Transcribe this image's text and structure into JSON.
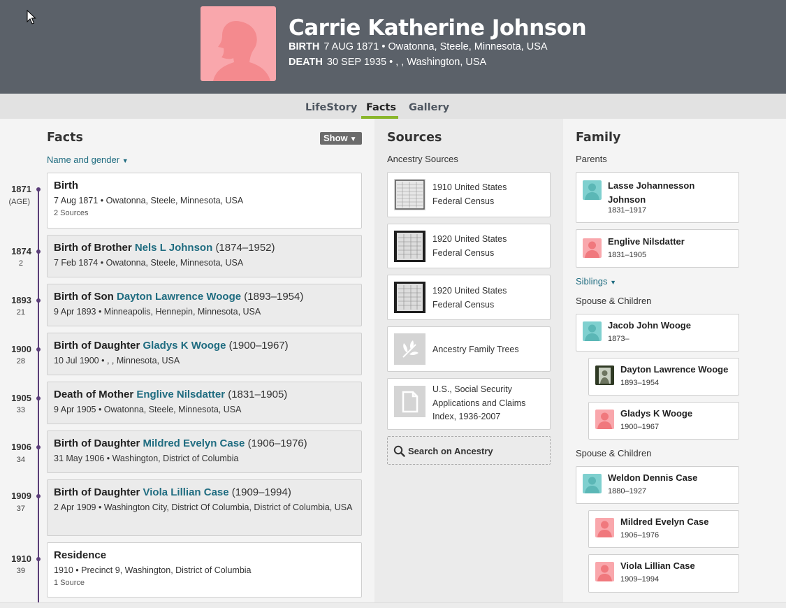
{
  "header": {
    "name": "Carrie Katherine Johnson",
    "birth_label": "BIRTH",
    "birth_value": "7 AUG 1871 • Owatonna, Steele, Minnesota, USA",
    "death_label": "DEATH",
    "death_value": "30 SEP 1935 • , , Washington, USA",
    "portrait_icon": "female-silhouette-icon",
    "portrait_color": "#f9a7ac"
  },
  "tabs": [
    "LifeStory",
    "Facts",
    "Gallery"
  ],
  "active_tab": "Facts",
  "facts": {
    "title": "Facts",
    "show_label": "Show",
    "name_gender_label": "Name and gender",
    "events": [
      {
        "year": "1871",
        "age": "(AGE)",
        "title": "Birth",
        "link": "",
        "years": "",
        "detail": "7 Aug 1871 • Owatonna, Steele, Minnesota, USA",
        "sources": "2 Sources"
      },
      {
        "year": "1874",
        "age": "2",
        "title": "Birth of Brother",
        "link": "Nels L Johnson",
        "years": "(1874–1952)",
        "detail": "7 Feb 1874 • Owatonna, Steele, Minnesota, USA",
        "sources": ""
      },
      {
        "year": "1893",
        "age": "21",
        "title": "Birth of Son",
        "link": "Dayton Lawrence Wooge",
        "years": "(1893–1954)",
        "detail": "9 Apr 1893 • Minneapolis, Hennepin, Minnesota, USA",
        "sources": ""
      },
      {
        "year": "1900",
        "age": "28",
        "title": "Birth of Daughter",
        "link": "Gladys K Wooge",
        "years": "(1900–1967)",
        "detail": "10 Jul 1900 • , , Minnesota, USA",
        "sources": ""
      },
      {
        "year": "1905",
        "age": "33",
        "title": "Death of Mother",
        "link": "Englive Nilsdatter",
        "years": "(1831–1905)",
        "detail": "9 Apr 1905 • Owatonna, Steele, Minnesota, USA",
        "sources": ""
      },
      {
        "year": "1906",
        "age": "34",
        "title": "Birth of Daughter",
        "link": "Mildred Evelyn Case",
        "years": "(1906–1976)",
        "detail": "31 May 1906 • Washington, District of Columbia",
        "sources": ""
      },
      {
        "year": "1909",
        "age": "37",
        "title": "Birth of Daughter",
        "link": "Viola Lillian Case",
        "years": "(1909–1994)",
        "detail": "2 Apr 1909 • Washington City, District Of Columbia, District of Columbia, USA",
        "sources": ""
      },
      {
        "year": "1910",
        "age": "39",
        "title": "Residence",
        "link": "",
        "years": "",
        "detail": "1910 • Precinct 9, Washington, District of Columbia",
        "sources": "1 Source"
      }
    ]
  },
  "sources": {
    "title": "Sources",
    "subtitle": "Ancestry Sources",
    "items": [
      {
        "line1": "1910 United States",
        "line2": "Federal Census",
        "line3": "",
        "icon": "census-document-thumb"
      },
      {
        "line1": "1920 United States",
        "line2": "Federal Census",
        "line3": "",
        "icon": "census-document-thumb"
      },
      {
        "line1": "1920 United States",
        "line2": "Federal Census",
        "line3": "",
        "icon": "census-document-thumb"
      },
      {
        "line1": "Ancestry Family Trees",
        "line2": "",
        "line3": "",
        "icon": "leaf-icon"
      },
      {
        "line1": "U.S., Social Security",
        "line2": "Applications and Claims",
        "line3": "Index, 1936-2007",
        "icon": "document-icon"
      }
    ],
    "search_label": "Search on Ancestry"
  },
  "family": {
    "title": "Family",
    "parents_label": "Parents",
    "parents": [
      {
        "name1": "Lasse Johannesson",
        "name2": "Johnson",
        "years": "1831–1917",
        "gender": "m"
      },
      {
        "name1": "Englive Nilsdatter",
        "name2": "",
        "years": "1831–1905",
        "gender": "f"
      }
    ],
    "siblings_label": "Siblings",
    "spouse_label": "Spouse & Children",
    "spouse1": {
      "name": "Jacob John Wooge",
      "years": "1873–"
    },
    "children1": [
      {
        "name": "Dayton Lawrence Wooge",
        "years": "1893–1954"
      },
      {
        "name": "Gladys K Wooge",
        "years": "1900–1967"
      }
    ],
    "spouse2": {
      "name": "Weldon Dennis Case",
      "years": "1880–1927"
    },
    "children2": [
      {
        "name": "Mildred Evelyn Case",
        "years": "1906–1976"
      },
      {
        "name": "Viola Lillian Case",
        "years": "1909–1994"
      }
    ]
  },
  "colors": {
    "header_bg": "#5b6169",
    "accent_green": "#8ab62c",
    "link_teal": "#1f6c80",
    "timeline_purple": "#5a3d78",
    "male_avatar": "#7fd0cf",
    "female_avatar": "#f9a7ac"
  }
}
